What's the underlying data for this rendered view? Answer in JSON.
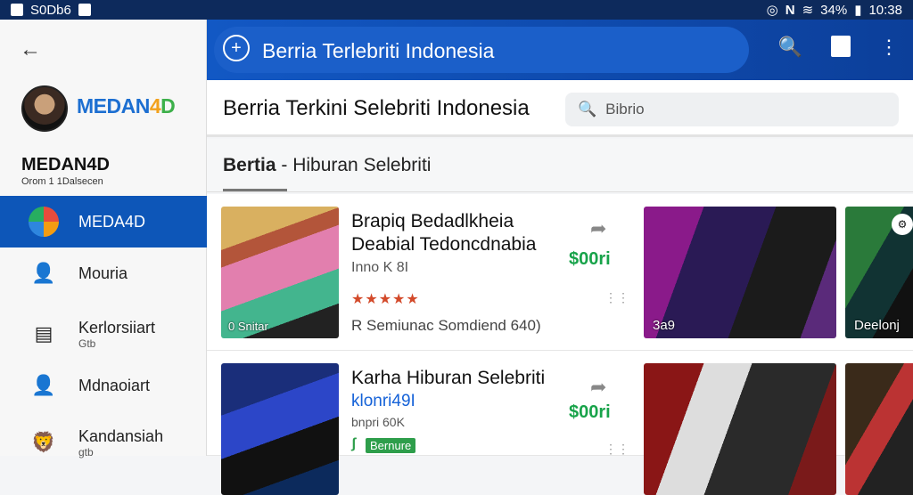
{
  "status_bar": {
    "left_text": "S0Db6",
    "battery": "34%",
    "time": "10:38"
  },
  "sidebar": {
    "brand": {
      "part1": "MEDAN",
      "part2": "4",
      "part3": "D"
    },
    "account_name": "MEDAN4D",
    "account_sub": "Orom 1 1Dalsecen",
    "items": [
      {
        "label": "MEDA4D",
        "sub": "",
        "icon": "globe-icon",
        "active": true
      },
      {
        "label": "Mouria",
        "sub": "",
        "icon": "person-icon",
        "active": false
      },
      {
        "label": "Kerlorsiiart",
        "sub": "Gtb",
        "icon": "list-icon",
        "active": false
      },
      {
        "label": "Mdnaoiart",
        "sub": "",
        "icon": "person-icon",
        "active": false
      },
      {
        "label": "Kandansiah",
        "sub": "gtb",
        "icon": "lion-icon",
        "active": false
      }
    ]
  },
  "appbar": {
    "title": "Berria Terlebriti Indonesia"
  },
  "header": {
    "title": "Berria Terkini  Selebriti Indonesia",
    "search_placeholder": "Bibrio"
  },
  "tab": {
    "bold": "Bertia",
    "rest": " - Hiburan Selebriti"
  },
  "cards": [
    {
      "title": "Brapiq Bedadlkheia Deabial Tedoncdnabia",
      "meta": "Inno K 8I",
      "stars": "★★★★★",
      "footer": "R Semiunac Somdiend 640)",
      "price": "$00ri",
      "thumb_caption": "0 Snitar",
      "video1_caption": "3a9",
      "video2_caption": "Deelonj"
    },
    {
      "title": "Karha Hiburan Selebriti",
      "link": "klonri49I",
      "meta": "bnpri 60K",
      "badge": "Bernure",
      "price": "$00ri"
    }
  ]
}
